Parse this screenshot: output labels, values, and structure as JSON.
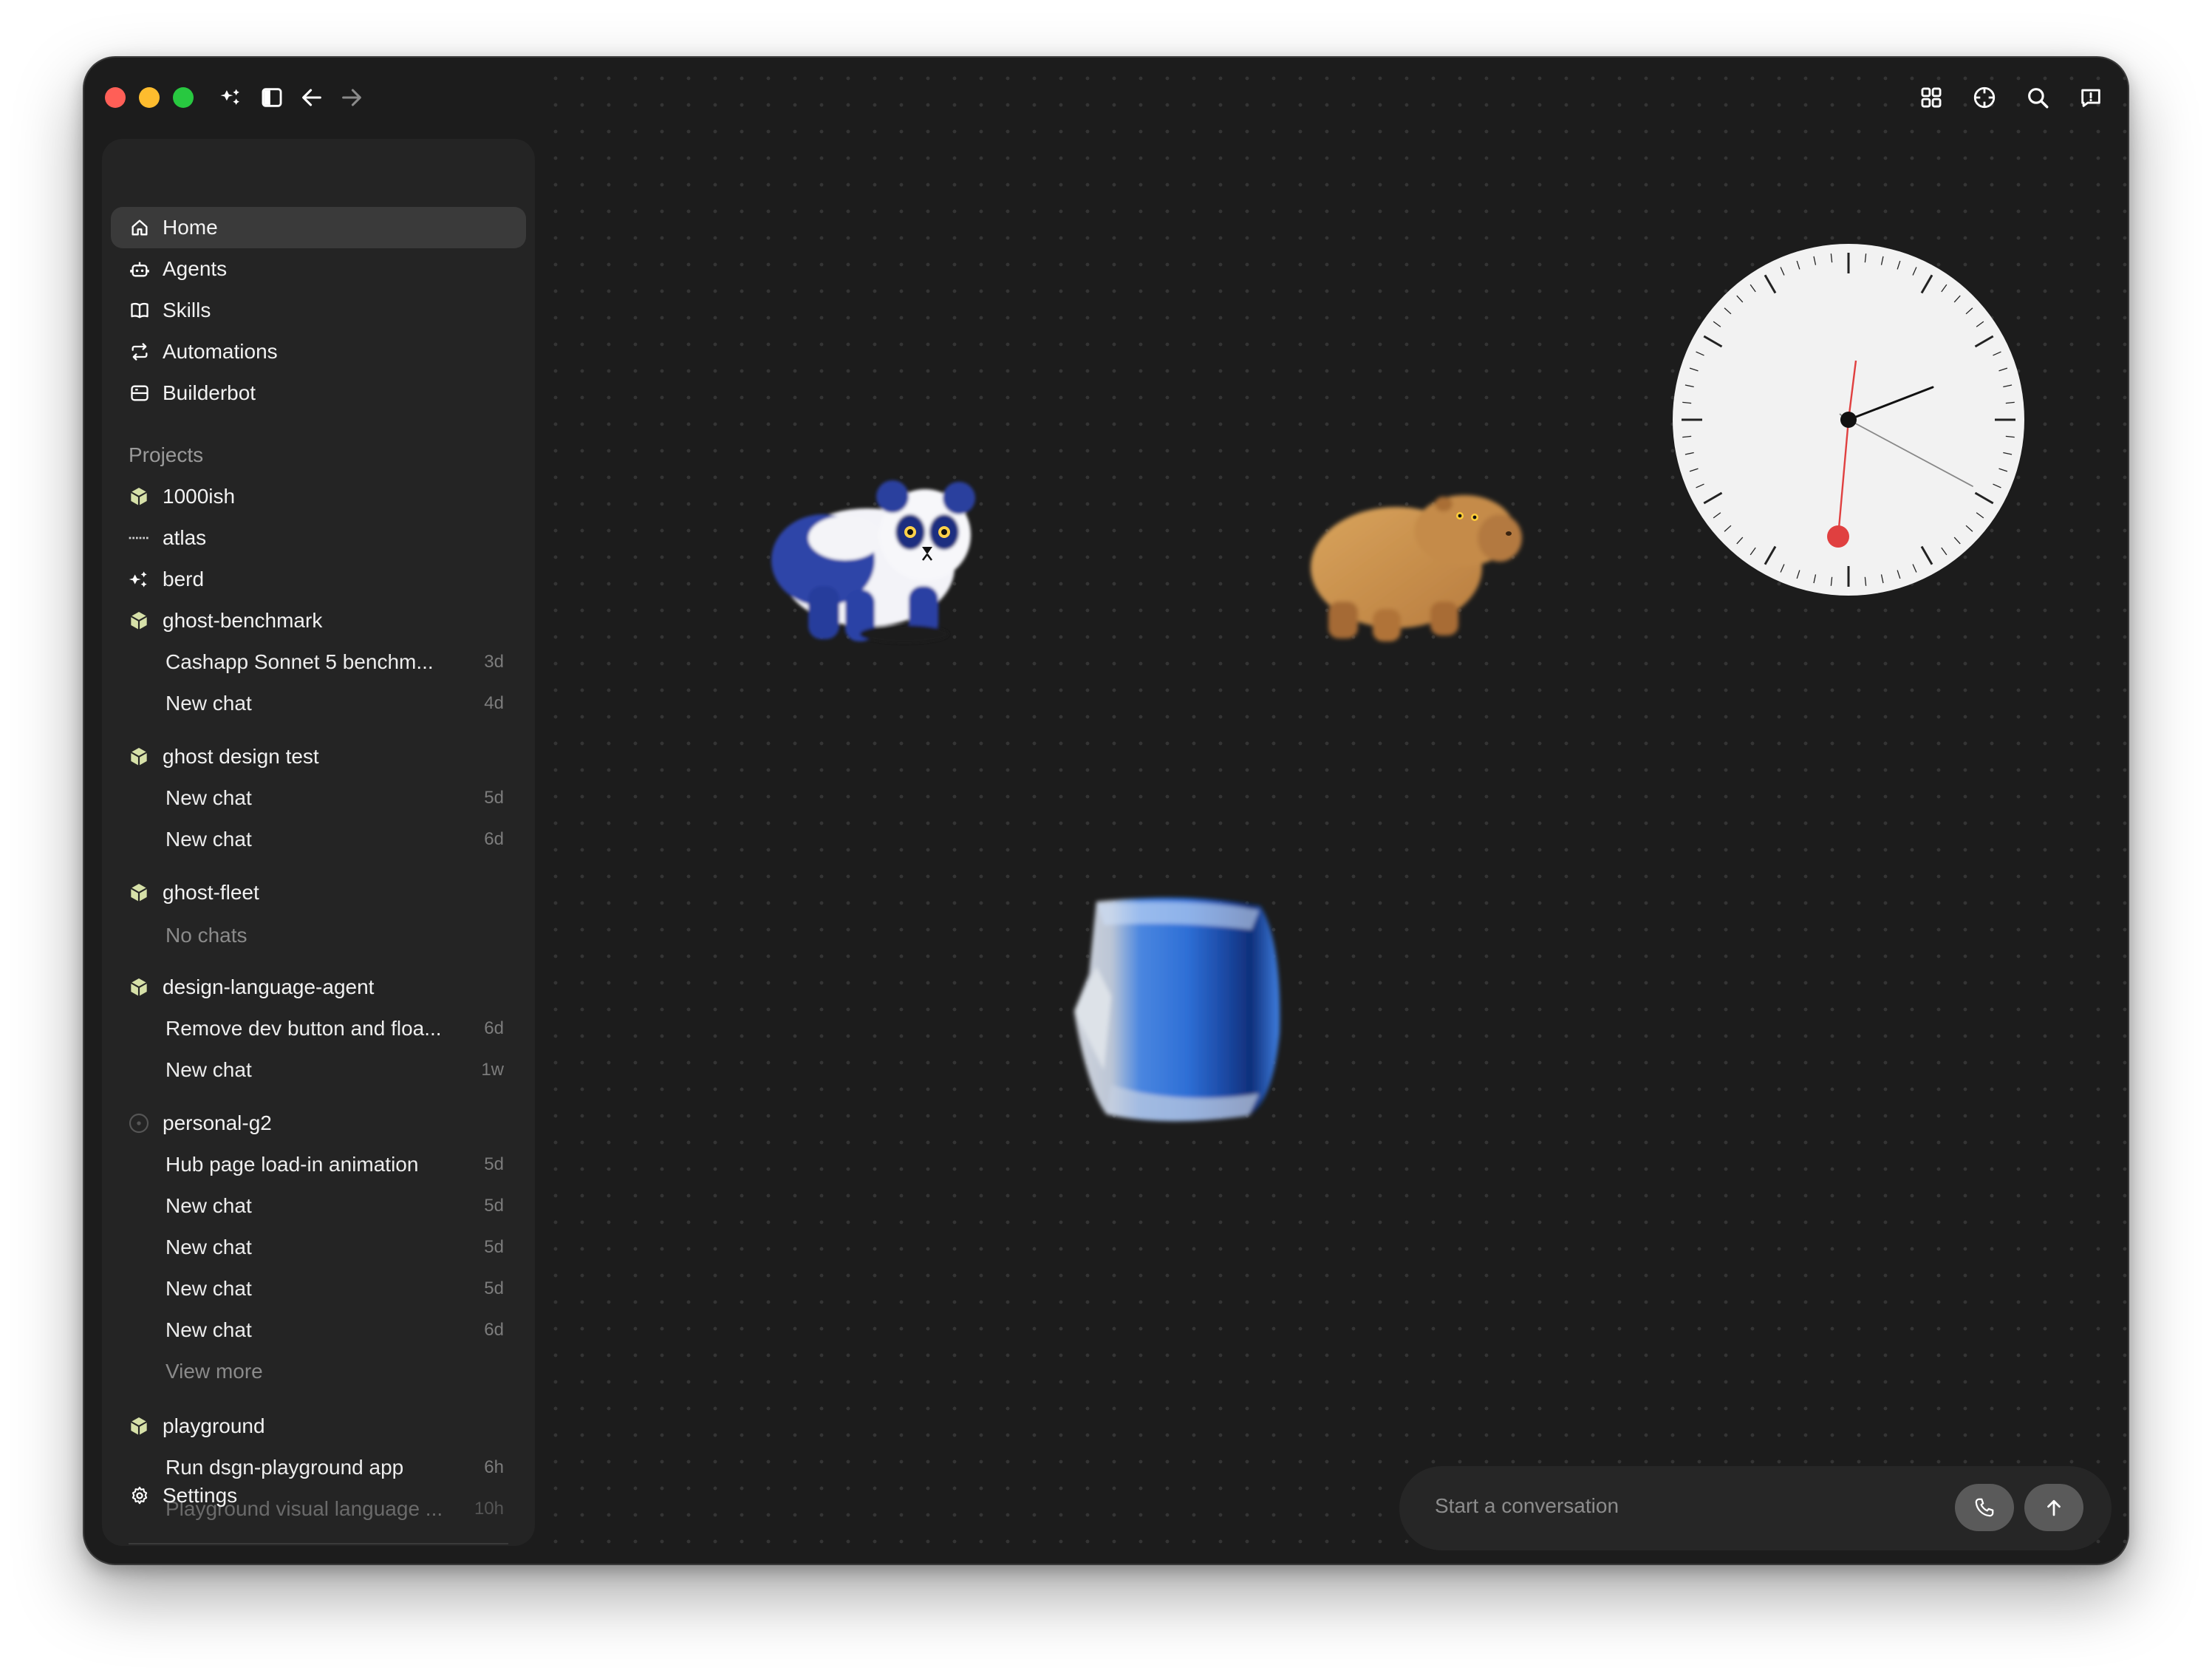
{
  "titlebar": {
    "icons": [
      "close-dot",
      "minimize-dot",
      "maximize-dot",
      "sparkle-icon",
      "sidebar-toggle-icon",
      "back-arrow-icon",
      "forward-arrow-icon",
      "grid-icon",
      "crosshair-icon",
      "search-icon",
      "feedback-icon"
    ]
  },
  "nav": {
    "items": [
      {
        "label": "Home",
        "icon": "home-icon",
        "active": true
      },
      {
        "label": "Agents",
        "icon": "robot-icon"
      },
      {
        "label": "Skills",
        "icon": "book-icon"
      },
      {
        "label": "Automations",
        "icon": "repeat-icon"
      },
      {
        "label": "Builderbot",
        "icon": "server-icon"
      }
    ]
  },
  "projects": {
    "heading": "Projects",
    "list": [
      {
        "name": "1000ish"
      },
      {
        "name": "atlas"
      },
      {
        "name": "berd"
      },
      {
        "name": "ghost-benchmark",
        "chats": [
          {
            "title": "Cashapp Sonnet 5 benchm...",
            "age": "3d"
          },
          {
            "title": "New chat",
            "age": "4d"
          }
        ]
      },
      {
        "name": "ghost design test",
        "chats": [
          {
            "title": "New chat",
            "age": "5d"
          },
          {
            "title": "New chat",
            "age": "6d"
          }
        ]
      },
      {
        "name": "ghost-fleet",
        "empty": "No chats"
      },
      {
        "name": "design-language-agent",
        "chats": [
          {
            "title": "Remove dev button and floa...",
            "age": "6d"
          },
          {
            "title": "New chat",
            "age": "1w"
          }
        ]
      },
      {
        "name": "personal-g2",
        "chats": [
          {
            "title": "Hub page load-in animation",
            "age": "5d"
          },
          {
            "title": "New chat",
            "age": "5d"
          },
          {
            "title": "New chat",
            "age": "5d"
          },
          {
            "title": "New chat",
            "age": "5d"
          },
          {
            "title": "New chat",
            "age": "6d"
          }
        ],
        "more": "View more"
      },
      {
        "name": "playground",
        "chats": [
          {
            "title": "Run dsgn-playground app",
            "age": "6h"
          },
          {
            "title": "Playground visual language ...",
            "age": "10h"
          }
        ]
      }
    ]
  },
  "footer": {
    "settings_label": "Settings"
  },
  "composer": {
    "placeholder": "Start a conversation"
  },
  "colors": {
    "window_bg": "#1c1c1c",
    "sidebar_bg": "#242424",
    "active_item": "#3a3a3a",
    "cube_icon": "#d6e0a8",
    "clock_second_hand": "#e04040"
  }
}
